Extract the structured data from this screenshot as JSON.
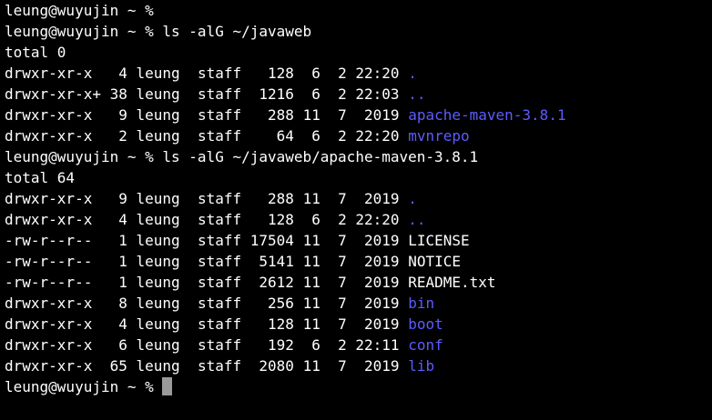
{
  "terminal": {
    "prompt": "leung@wuyujin ~ % ",
    "lines": [
      {
        "type": "prompt",
        "command": ""
      },
      {
        "type": "prompt",
        "command": "ls -alG ~/javaweb"
      },
      {
        "type": "text",
        "text": "total 0"
      },
      {
        "type": "entry",
        "perms": "drwxr-xr-x ",
        "links": " 4",
        "owner": "leung",
        "group": "staff",
        "size": "128",
        "month": " 6",
        "day": " 2",
        "time": "22:20",
        "name": ".",
        "is_dir": true
      },
      {
        "type": "entry",
        "perms": "drwxr-xr-x+",
        "links": "38",
        "owner": "leung",
        "group": "staff",
        "size": "1216",
        "month": " 6",
        "day": " 2",
        "time": "22:03",
        "name": "..",
        "is_dir": true
      },
      {
        "type": "entry",
        "perms": "drwxr-xr-x ",
        "links": " 9",
        "owner": "leung",
        "group": "staff",
        "size": "288",
        "month": "11",
        "day": " 7",
        "time": " 2019",
        "name": "apache-maven-3.8.1",
        "is_dir": true
      },
      {
        "type": "entry",
        "perms": "drwxr-xr-x ",
        "links": " 2",
        "owner": "leung",
        "group": "staff",
        "size": "64",
        "month": " 6",
        "day": " 2",
        "time": "22:20",
        "name": "mvnrepo",
        "is_dir": true
      },
      {
        "type": "prompt",
        "command": "ls -alG ~/javaweb/apache-maven-3.8.1"
      },
      {
        "type": "text",
        "text": "total 64"
      },
      {
        "type": "entry",
        "perms": "drwxr-xr-x ",
        "links": " 9",
        "owner": "leung",
        "group": "staff",
        "size": "288",
        "month": "11",
        "day": " 7",
        "time": " 2019",
        "name": ".",
        "is_dir": true
      },
      {
        "type": "entry",
        "perms": "drwxr-xr-x ",
        "links": " 4",
        "owner": "leung",
        "group": "staff",
        "size": "128",
        "month": " 6",
        "day": " 2",
        "time": "22:20",
        "name": "..",
        "is_dir": true
      },
      {
        "type": "entry",
        "perms": "-rw-r--r-- ",
        "links": " 1",
        "owner": "leung",
        "group": "staff",
        "size": "17504",
        "month": "11",
        "day": " 7",
        "time": " 2019",
        "name": "LICENSE",
        "is_dir": false
      },
      {
        "type": "entry",
        "perms": "-rw-r--r-- ",
        "links": " 1",
        "owner": "leung",
        "group": "staff",
        "size": "5141",
        "month": "11",
        "day": " 7",
        "time": " 2019",
        "name": "NOTICE",
        "is_dir": false
      },
      {
        "type": "entry",
        "perms": "-rw-r--r-- ",
        "links": " 1",
        "owner": "leung",
        "group": "staff",
        "size": "2612",
        "month": "11",
        "day": " 7",
        "time": " 2019",
        "name": "README.txt",
        "is_dir": false
      },
      {
        "type": "entry",
        "perms": "drwxr-xr-x ",
        "links": " 8",
        "owner": "leung",
        "group": "staff",
        "size": "256",
        "month": "11",
        "day": " 7",
        "time": " 2019",
        "name": "bin",
        "is_dir": true
      },
      {
        "type": "entry",
        "perms": "drwxr-xr-x ",
        "links": " 4",
        "owner": "leung",
        "group": "staff",
        "size": "128",
        "month": "11",
        "day": " 7",
        "time": " 2019",
        "name": "boot",
        "is_dir": true
      },
      {
        "type": "entry",
        "perms": "drwxr-xr-x ",
        "links": " 6",
        "owner": "leung",
        "group": "staff",
        "size": "192",
        "month": " 6",
        "day": " 2",
        "time": "22:11",
        "name": "conf",
        "is_dir": true
      },
      {
        "type": "entry",
        "perms": "drwxr-xr-x ",
        "links": "65",
        "owner": "leung",
        "group": "staff",
        "size": "2080",
        "month": "11",
        "day": " 7",
        "time": " 2019",
        "name": "lib",
        "is_dir": true
      },
      {
        "type": "prompt",
        "command": "",
        "cursor": true
      }
    ]
  },
  "colors": {
    "background": "#000000",
    "text": "#ffffff",
    "directory": "#5c5cff",
    "cursor": "#9a9a9a"
  }
}
